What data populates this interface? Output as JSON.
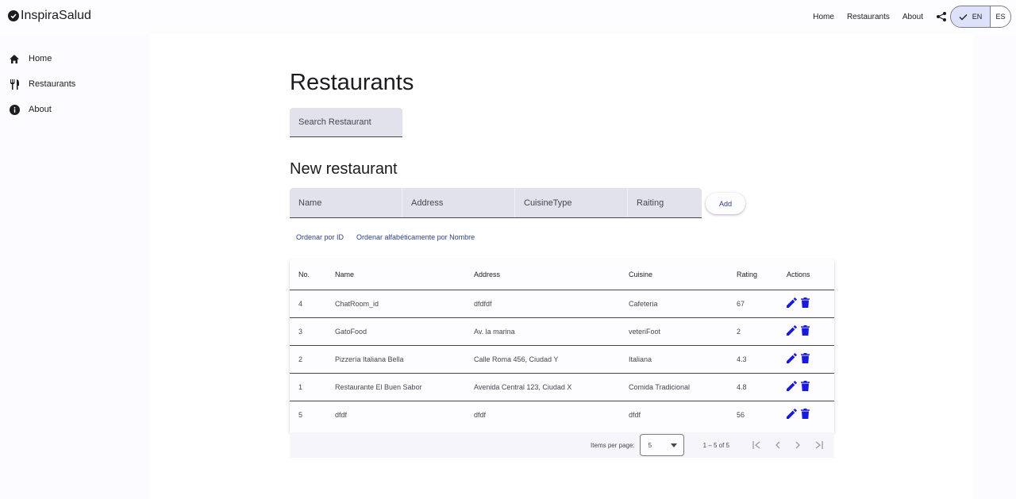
{
  "app": {
    "title": "InspiraSalud"
  },
  "topnav": {
    "items": [
      "Home",
      "Restaurants",
      "About"
    ]
  },
  "lang": {
    "selected": "EN",
    "other": "ES"
  },
  "sidebar": {
    "items": [
      {
        "label": "Home",
        "icon": "home-icon"
      },
      {
        "label": "Restaurants",
        "icon": "restaurant-icon"
      },
      {
        "label": "About",
        "icon": "info-icon"
      }
    ]
  },
  "page": {
    "title": "Restaurants",
    "search_placeholder": "Search Restaurant"
  },
  "form": {
    "title": "New restaurant",
    "fields": [
      "Name",
      "Address",
      "CuisineType",
      "Raiting"
    ],
    "add_label": "Add"
  },
  "sort": {
    "by_id": "Ordenar por ID",
    "by_name": "Ordenar alfabéticamente por Nombre"
  },
  "table": {
    "headers": [
      "No.",
      "Name",
      "Address",
      "Cuisine",
      "Rating",
      "Actions"
    ],
    "rows": [
      {
        "no": "4",
        "name": "ChatRoom_id",
        "address": "dfdfdf",
        "cuisine": "Cafeteria",
        "rating": "67"
      },
      {
        "no": "3",
        "name": "GatoFood",
        "address": "Av. la marina",
        "cuisine": "veteriFoot",
        "rating": "2"
      },
      {
        "no": "2",
        "name": "Pizzería Italiana Bella",
        "address": "Calle Roma 456, Ciudad Y",
        "cuisine": "Italiana",
        "rating": "4.3"
      },
      {
        "no": "1",
        "name": "Restaurante El Buen Sabor",
        "address": "Avenida Central 123, Ciudad X",
        "cuisine": "Comida Tradicional",
        "rating": "4.8"
      },
      {
        "no": "5",
        "name": "dfdf",
        "address": "dfdf",
        "cuisine": "dfdf",
        "rating": "56"
      }
    ]
  },
  "paginator": {
    "items_per_page_label": "Items per page:",
    "page_size": "5",
    "range": "1 – 5 of 5"
  },
  "colors": {
    "action_icon": "#1a1adb",
    "link": "#2a3f8f"
  }
}
